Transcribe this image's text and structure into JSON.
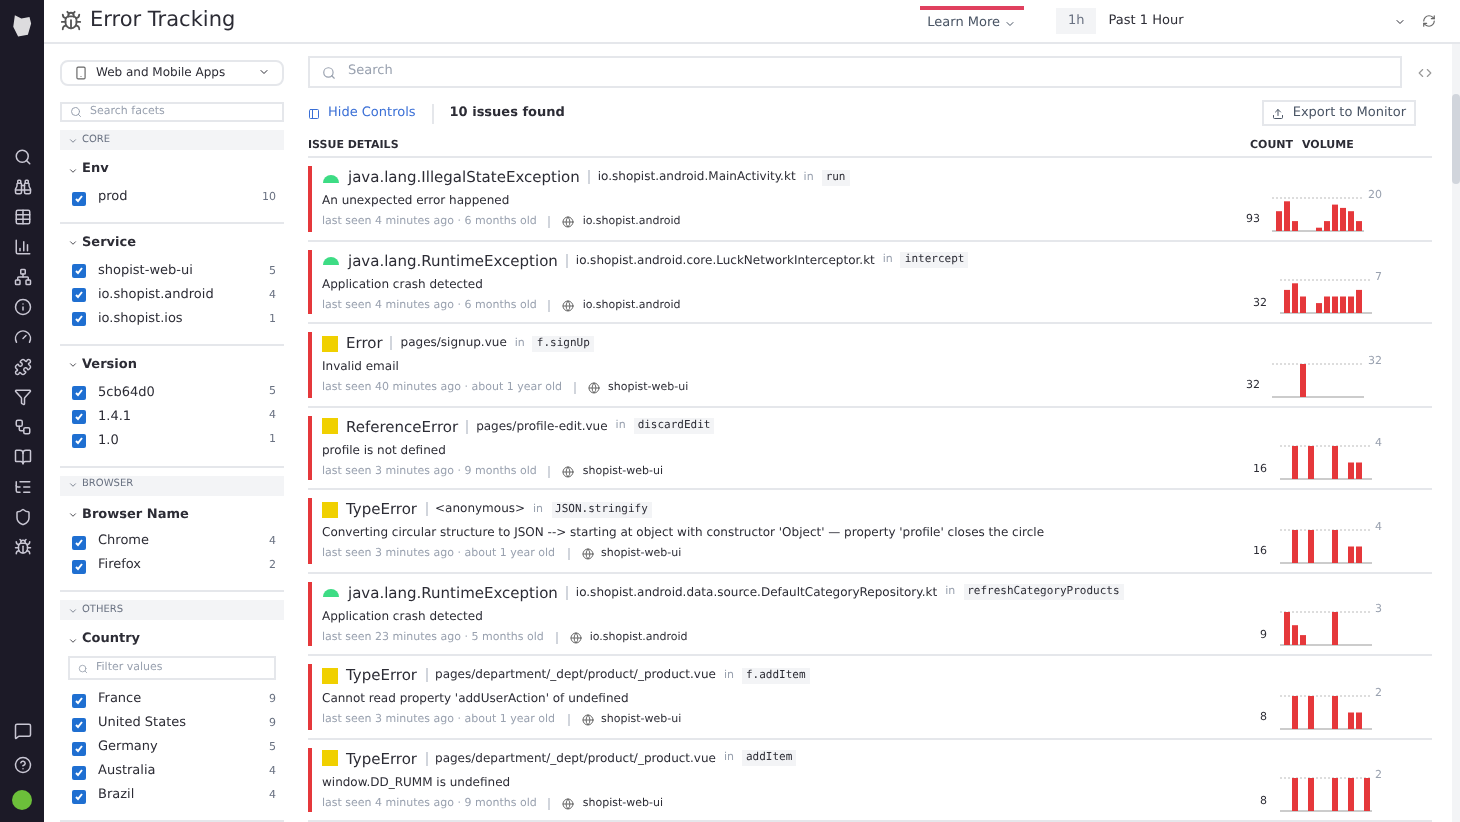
{
  "header": {
    "title": "Error Tracking",
    "learn_more": "Learn More",
    "time_badge": "1h",
    "time_range": "Past 1 Hour"
  },
  "sidebar": {
    "app_selector": "Web and Mobile Apps",
    "search": {
      "placeholder": "Search facets"
    },
    "groups": [
      {
        "label": "CORE",
        "facets": [
          {
            "name": "Env",
            "items": [
              {
                "label": "prod",
                "count": "10",
                "checked": true
              }
            ]
          },
          {
            "name": "Service",
            "items": [
              {
                "label": "shopist-web-ui",
                "count": "5",
                "checked": true
              },
              {
                "label": "io.shopist.android",
                "count": "4",
                "checked": true
              },
              {
                "label": "io.shopist.ios",
                "count": "1",
                "checked": true
              }
            ]
          },
          {
            "name": "Version",
            "items": [
              {
                "label": "5cb64d0",
                "count": "5",
                "checked": true
              },
              {
                "label": "1.4.1",
                "count": "4",
                "checked": true
              },
              {
                "label": "1.0",
                "count": "1",
                "checked": true
              }
            ]
          }
        ]
      },
      {
        "label": "BROWSER",
        "facets": [
          {
            "name": "Browser Name",
            "items": [
              {
                "label": "Chrome",
                "count": "4",
                "checked": true
              },
              {
                "label": "Firefox",
                "count": "2",
                "checked": true
              }
            ]
          }
        ]
      },
      {
        "label": "OTHERS",
        "facets": [
          {
            "name": "Country",
            "filter": {
              "placeholder": "Filter values"
            },
            "items": [
              {
                "label": "France",
                "count": "9",
                "checked": true
              },
              {
                "label": "United States",
                "count": "9",
                "checked": true
              },
              {
                "label": "Germany",
                "count": "5",
                "checked": true
              },
              {
                "label": "Australia",
                "count": "4",
                "checked": true
              },
              {
                "label": "Brazil",
                "count": "4",
                "checked": true
              }
            ]
          }
        ]
      }
    ]
  },
  "search": {
    "placeholder": "Search"
  },
  "controls": {
    "hide": "Hide Controls",
    "found": "10 issues found",
    "export": "Export to Monitor"
  },
  "table": {
    "columns": [
      "ISSUE DETAILS",
      "COUNT",
      "VOLUME"
    ],
    "rows": [
      {
        "kind": "android",
        "type": "java.lang.IllegalStateException",
        "source": [
          {
            "kind": "file",
            "text": "io.shopist.android.MainActivity.kt"
          },
          {
            "kind": "word",
            "text": "in"
          },
          {
            "kind": "code",
            "text": "run"
          }
        ],
        "message": "An unexpected error happened",
        "seen": "last seen 4 minutes ago · 6 months old",
        "service": "io.shopist.android",
        "count": "93",
        "max": "20"
      },
      {
        "kind": "android",
        "type": "java.lang.RuntimeException",
        "source": [
          {
            "kind": "file",
            "text": "io.shopist.android.core.LuckNetworkInterceptor.kt"
          },
          {
            "kind": "word",
            "text": "in"
          },
          {
            "kind": "code",
            "text": "intercept"
          }
        ],
        "message": "Application crash detected",
        "seen": "last seen 4 minutes ago · 6 months old",
        "service": "io.shopist.android",
        "count": "32",
        "max": "7"
      },
      {
        "kind": "javascript",
        "type": "Error",
        "source": [
          {
            "kind": "file",
            "text": "pages/signup.vue"
          },
          {
            "kind": "word",
            "text": "in"
          },
          {
            "kind": "code",
            "text": "f.signUp"
          }
        ],
        "message": "Invalid email",
        "seen": "last seen 40 minutes ago · about 1 year old",
        "service": "shopist-web-ui",
        "count": "32",
        "max": "32"
      },
      {
        "kind": "javascript",
        "type": "ReferenceError",
        "source": [
          {
            "kind": "file",
            "text": "pages/profile-edit.vue"
          },
          {
            "kind": "word",
            "text": "in"
          },
          {
            "kind": "code",
            "text": "discardEdit"
          }
        ],
        "message": "profile is not defined",
        "seen": "last seen 3 minutes ago · 9 months old",
        "service": "shopist-web-ui",
        "count": "16",
        "max": "4"
      },
      {
        "kind": "javascript",
        "type": "TypeError",
        "source": [
          {
            "kind": "file",
            "text": "<anonymous>"
          },
          {
            "kind": "word",
            "text": "in"
          },
          {
            "kind": "code",
            "text": "JSON.stringify"
          }
        ],
        "message": "Converting circular structure to JSON --> starting at object with constructor 'Object' — property 'profile' closes the circle",
        "seen": "last seen 3 minutes ago · about 1 year old",
        "service": "shopist-web-ui",
        "count": "16",
        "max": "4"
      },
      {
        "kind": "android",
        "type": "java.lang.RuntimeException",
        "source": [
          {
            "kind": "file",
            "text": "io.shopist.android.data.source.DefaultCategoryRepository.kt"
          },
          {
            "kind": "word",
            "text": "in"
          },
          {
            "kind": "code",
            "text": "refreshCategoryProducts"
          }
        ],
        "message": "Application crash detected",
        "seen": "last seen 23 minutes ago · 5 months old",
        "service": "io.shopist.android",
        "count": "9",
        "max": "3"
      },
      {
        "kind": "javascript",
        "type": "TypeError",
        "source": [
          {
            "kind": "file",
            "text": "pages/department/_dept/product/_product.vue"
          },
          {
            "kind": "word",
            "text": "in"
          },
          {
            "kind": "code",
            "text": "f.addItem"
          }
        ],
        "message": "Cannot read property 'addUserAction' of undefined",
        "seen": "last seen 3 minutes ago · about 1 year old",
        "service": "shopist-web-ui",
        "count": "8",
        "max": "2"
      },
      {
        "kind": "javascript",
        "type": "TypeError",
        "source": [
          {
            "kind": "file",
            "text": "pages/department/_dept/product/_product.vue"
          },
          {
            "kind": "word",
            "text": "in"
          },
          {
            "kind": "code",
            "text": "addItem"
          }
        ],
        "message": "window.DD_RUMM is undefined",
        "seen": "last seen 4 minutes ago · 9 months old",
        "service": "shopist-web-ui",
        "count": "8",
        "max": "2"
      }
    ]
  }
}
